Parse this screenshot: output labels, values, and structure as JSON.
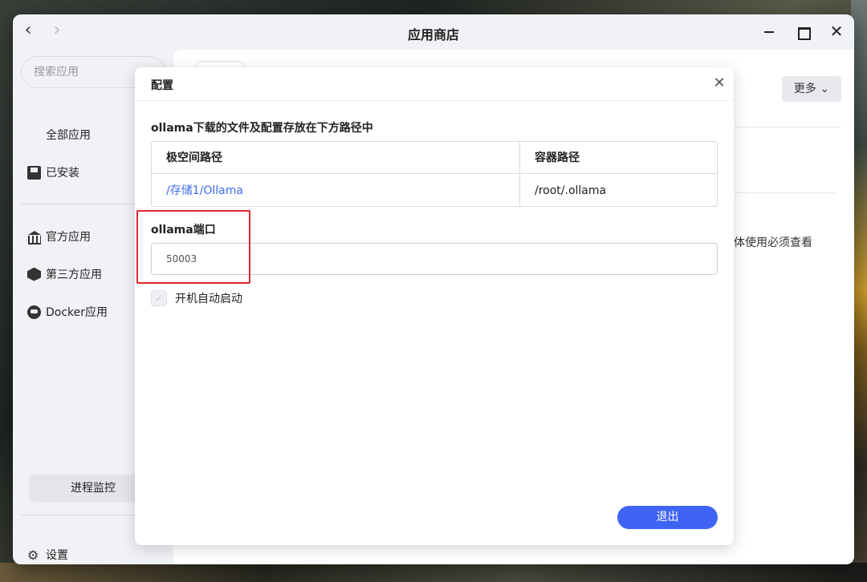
{
  "window": {
    "title": "应用商店",
    "nav_back": "‹",
    "nav_forward": "›",
    "close_glyph": "✕"
  },
  "sidebar": {
    "search_placeholder": "搜索应用",
    "refresh_glyph": "↻",
    "items": [
      {
        "label": "全部应用",
        "icon": "grid-icon"
      },
      {
        "label": "已安装",
        "icon": "installed-icon"
      },
      {
        "label": "官方应用",
        "icon": "bank-icon"
      },
      {
        "label": "第三方应用",
        "icon": "cube-icon"
      },
      {
        "label": "Docker应用",
        "icon": "docker-icon"
      }
    ],
    "process_monitor": "进程监控",
    "settings": "设置",
    "settings_glyph": "⚙"
  },
  "main": {
    "more_button": "更多 ⌄",
    "partial_text": "体使用必须查看"
  },
  "modal": {
    "title": "配置",
    "close_glyph": "✕",
    "path_section_title": "ollama下载的文件及配置存放在下方路径中",
    "table": {
      "headers": [
        "极空间路径",
        "容器路径"
      ],
      "rows": [
        [
          "/存储1/Ollama",
          "/root/.ollama"
        ]
      ]
    },
    "port_label": "ollama端口",
    "port_value": "50003",
    "autostart_label": "开机自动启动",
    "autostart_checked": true,
    "checkmark_glyph": "✓",
    "exit_button": "退出"
  },
  "colors": {
    "accent": "#3f64f5",
    "link": "#3d6cf0",
    "highlight": "#e0262b"
  }
}
